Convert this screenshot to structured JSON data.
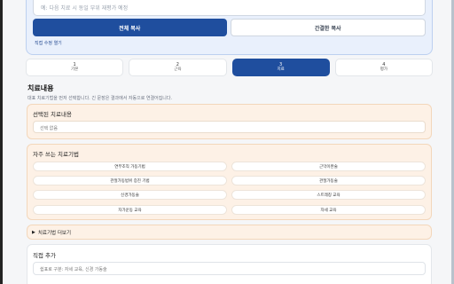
{
  "memo": {
    "placeholder": "예: 다음 치료 시 동일 부위 재평가 예정"
  },
  "actions": {
    "copy_all": "전체 복사",
    "copy_simple": "간결한 복사",
    "edit_link": "직접 수정 열기"
  },
  "steps": [
    {
      "num": "1",
      "label": "기본",
      "active": false
    },
    {
      "num": "2",
      "label": "근육",
      "active": false
    },
    {
      "num": "3",
      "label": "치료",
      "active": true
    },
    {
      "num": "4",
      "label": "평가",
      "active": false
    }
  ],
  "treatment": {
    "title": "치료내용",
    "description": "대표 치료기법을 먼저 선택합니다. 긴 문장은 결과에서 자동으로 연결어집니다.",
    "selected": {
      "title": "선택된 치료내용",
      "empty": "선택 없음"
    },
    "frequent": {
      "title": "자주 쓰는 치료기법",
      "items": [
        "연부조직 가동기법",
        "근막이완술",
        "관절가동범위 증진 기법",
        "관절가동술",
        "신경가동술",
        "스트레칭 교육",
        "자가운동 교육",
        "자세 교육"
      ]
    },
    "more": "치료기법 더보기",
    "direct": {
      "title": "직접 추가",
      "placeholder": "쉼표로 구분: 자세 교육, 신경 가동술"
    }
  },
  "colors": {
    "primary": "#1f4e9e",
    "card_bg": "#fdf1e6",
    "card_border": "#f3d7bb",
    "top_card_bg": "#e9f0fc"
  },
  "icons": {
    "more_toggle": "triangle-right-icon"
  }
}
